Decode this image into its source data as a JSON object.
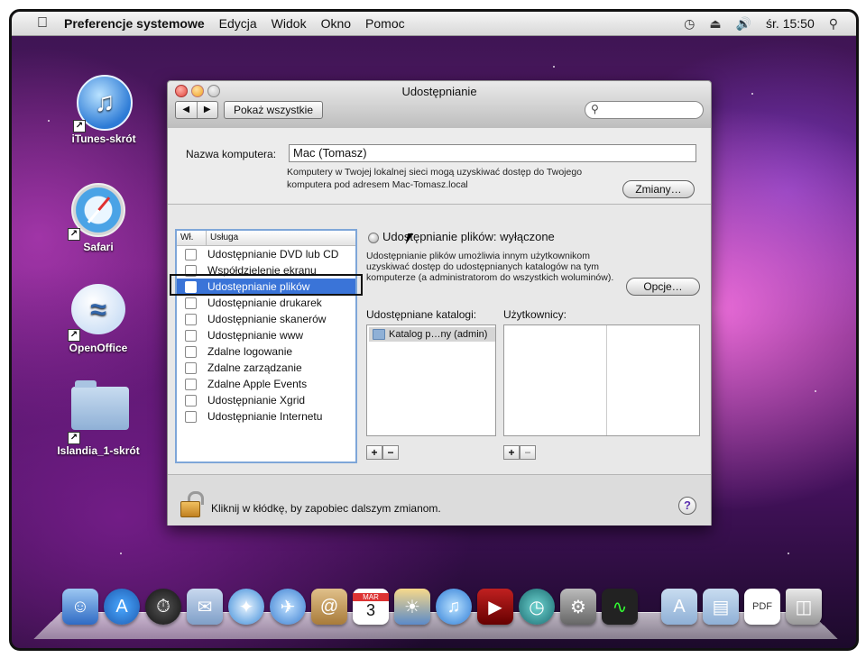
{
  "menubar": {
    "app_name": "Preferencje systemowe",
    "items": [
      "Edycja",
      "Widok",
      "Okno",
      "Pomoc"
    ],
    "clock": "śr. 15:50"
  },
  "desktop_icons": [
    {
      "label": "iTunes-skrót"
    },
    {
      "label": "Safari"
    },
    {
      "label": "OpenOffice"
    },
    {
      "label": "Islandia_1-skrót"
    }
  ],
  "window": {
    "title": "Udostępnianie",
    "show_all": "Pokaż wszystkie",
    "search_placeholder": "",
    "computer_name_label": "Nazwa komputera:",
    "computer_name_value": "Mac (Tomasz)",
    "computer_name_desc": "Komputery w Twojej lokalnej sieci mogą uzyskiwać dostęp do Twojego komputera pod adresem Mac-Tomasz.local",
    "change_button": "Zmiany…",
    "list_header_on": "Wł.",
    "list_header_service": "Usługa",
    "services": [
      {
        "label": "Udostępnianie DVD lub CD",
        "checked": false
      },
      {
        "label": "Współdzielenie ekranu",
        "checked": false
      },
      {
        "label": "Udostępnianie plików",
        "checked": false
      },
      {
        "label": "Udostępnianie drukarek",
        "checked": false
      },
      {
        "label": "Udostępnianie skanerów",
        "checked": false
      },
      {
        "label": "Udostępnianie www",
        "checked": false
      },
      {
        "label": "Zdalne logowanie",
        "checked": false
      },
      {
        "label": "Zdalne zarządzanie",
        "checked": false
      },
      {
        "label": "Zdalne Apple Events",
        "checked": false
      },
      {
        "label": "Udostępnianie Xgrid",
        "checked": false
      },
      {
        "label": "Udostępnianie Internetu",
        "checked": false
      }
    ],
    "status_title": "Udostępnianie plików: wyłączone",
    "status_desc": "Udostępnianie plików umożliwia innym użytkownikom uzyskiwać dostęp do udostępnianych katalogów na tym komputerze (a administratorom do wszystkich woluminów).",
    "options_button": "Opcje…",
    "shared_folders_label": "Udostępniane katalogi:",
    "users_label": "Użytkownicy:",
    "shared_folders": [
      "Katalog p…ny (admin)"
    ],
    "plus": "+",
    "minus": "−",
    "lock_text": "Kliknij w kłódkę, by zapobiec dalszym zmianom.",
    "help": "?"
  },
  "dock_icons": [
    "finder-icon",
    "app-store-icon",
    "dashboard-icon",
    "mail-icon",
    "safari-icon",
    "ichat-icon",
    "address-book-icon",
    "ical-icon",
    "iphoto-icon",
    "itunes-icon",
    "front-row-icon",
    "time-machine-icon",
    "system-preferences-icon",
    "activity-monitor-icon",
    "applications-folder-icon",
    "documents-folder-icon",
    "pdf-document-icon",
    "trash-icon"
  ],
  "ical_day": "3",
  "ical_month": "MAR"
}
